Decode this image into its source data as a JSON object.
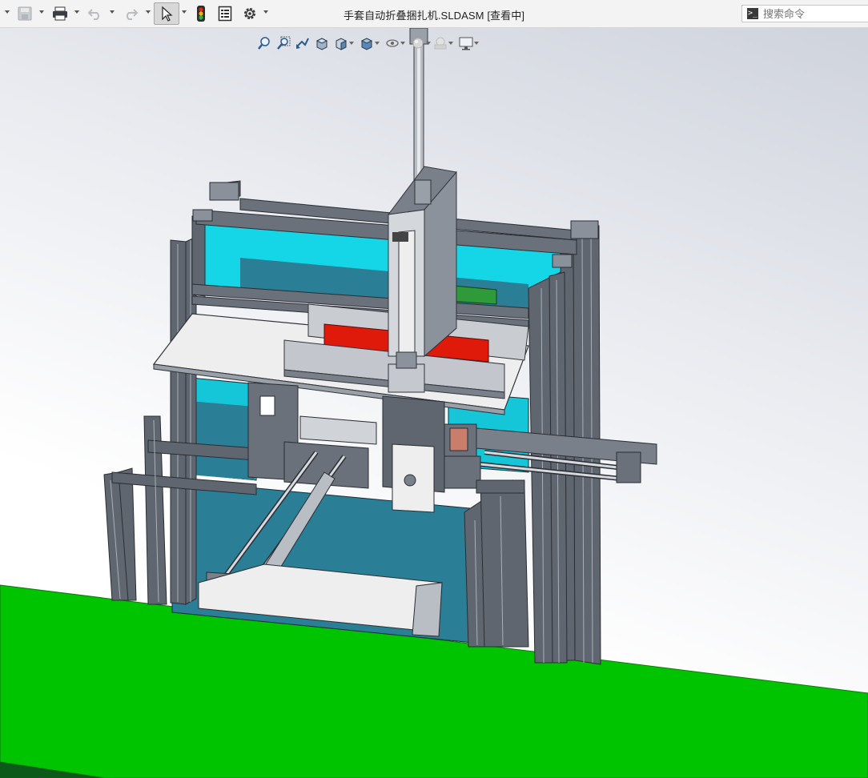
{
  "window": {
    "title": "手套自动折叠捆扎机.SLDASM [查看中]"
  },
  "toolbar": {
    "buttons": [
      {
        "name": "save-icon",
        "enabled": false
      },
      {
        "name": "print-icon",
        "enabled": true
      },
      {
        "name": "undo-icon",
        "enabled": false
      },
      {
        "name": "redo-icon",
        "enabled": false
      },
      {
        "name": "select-pointer-icon",
        "enabled": true,
        "active": true
      },
      {
        "name": "rebuild-traffic-light-icon",
        "enabled": true
      },
      {
        "name": "file-properties-icon",
        "enabled": true
      },
      {
        "name": "options-gear-icon",
        "enabled": true
      }
    ]
  },
  "search": {
    "placeholder": "搜索命令"
  },
  "headsup_toolbar": {
    "items": [
      "zoom-to-fit-icon",
      "zoom-to-area-icon",
      "previous-view-icon",
      "section-view-icon",
      "view-orientation-icon",
      "display-style-icon",
      "hide-show-items-icon",
      "edit-appearance-icon",
      "apply-scene-icon",
      "view-settings-icon"
    ]
  },
  "colors": {
    "ground": "#00c400",
    "frame": "#5f6670",
    "panel_cyan": "#15d6e6",
    "panel_teal": "#2a7f96",
    "red_block": "#e01a0a",
    "green_strip": "#2f9a3a",
    "plate_light": "#eeeeee"
  }
}
